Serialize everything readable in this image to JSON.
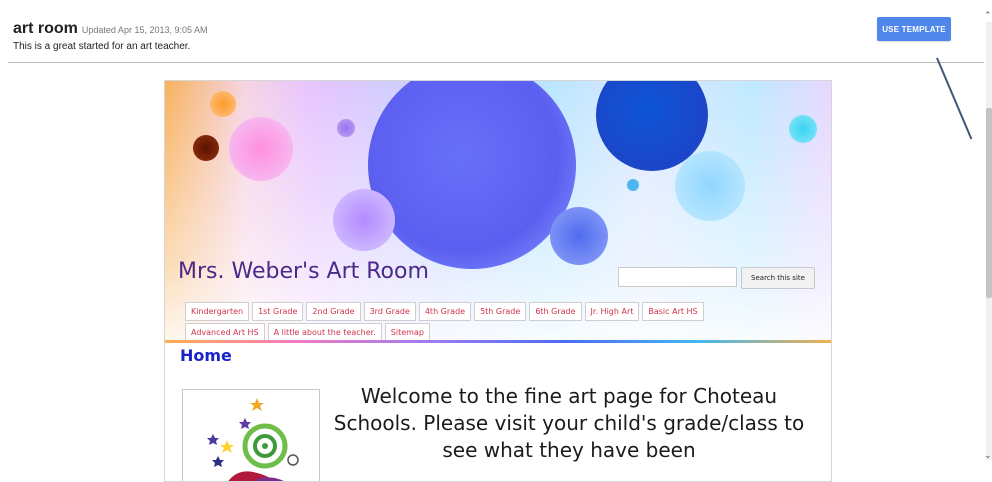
{
  "header": {
    "template_name": "art room",
    "updated": "Updated Apr 15, 2013, 9:05 AM",
    "description": "This is a great started for an art teacher.",
    "use_template_label": "USE TEMPLATE"
  },
  "preview": {
    "site_title": "Mrs. Weber's Art Room",
    "search": {
      "placeholder": "",
      "button_label": "Search this site"
    },
    "nav_row1": [
      "Kindergarten",
      "1st Grade",
      "2nd Grade",
      "3rd Grade",
      "4th Grade",
      "5th Grade",
      "6th Grade",
      "Jr. High Art",
      "Basic Art HS"
    ],
    "nav_row2": [
      "Advanced Art HS",
      "A little about the teacher.",
      "Sitemap"
    ],
    "page_heading": "Home",
    "welcome_text": "Welcome to the fine art page for Choteau Schools. Please visit your child's grade/class to see what they have been"
  },
  "colors": {
    "accent_button": "#4f86ec",
    "site_title": "#4b2a88",
    "nav_text": "#d1334c",
    "heading": "#1a23c9"
  }
}
